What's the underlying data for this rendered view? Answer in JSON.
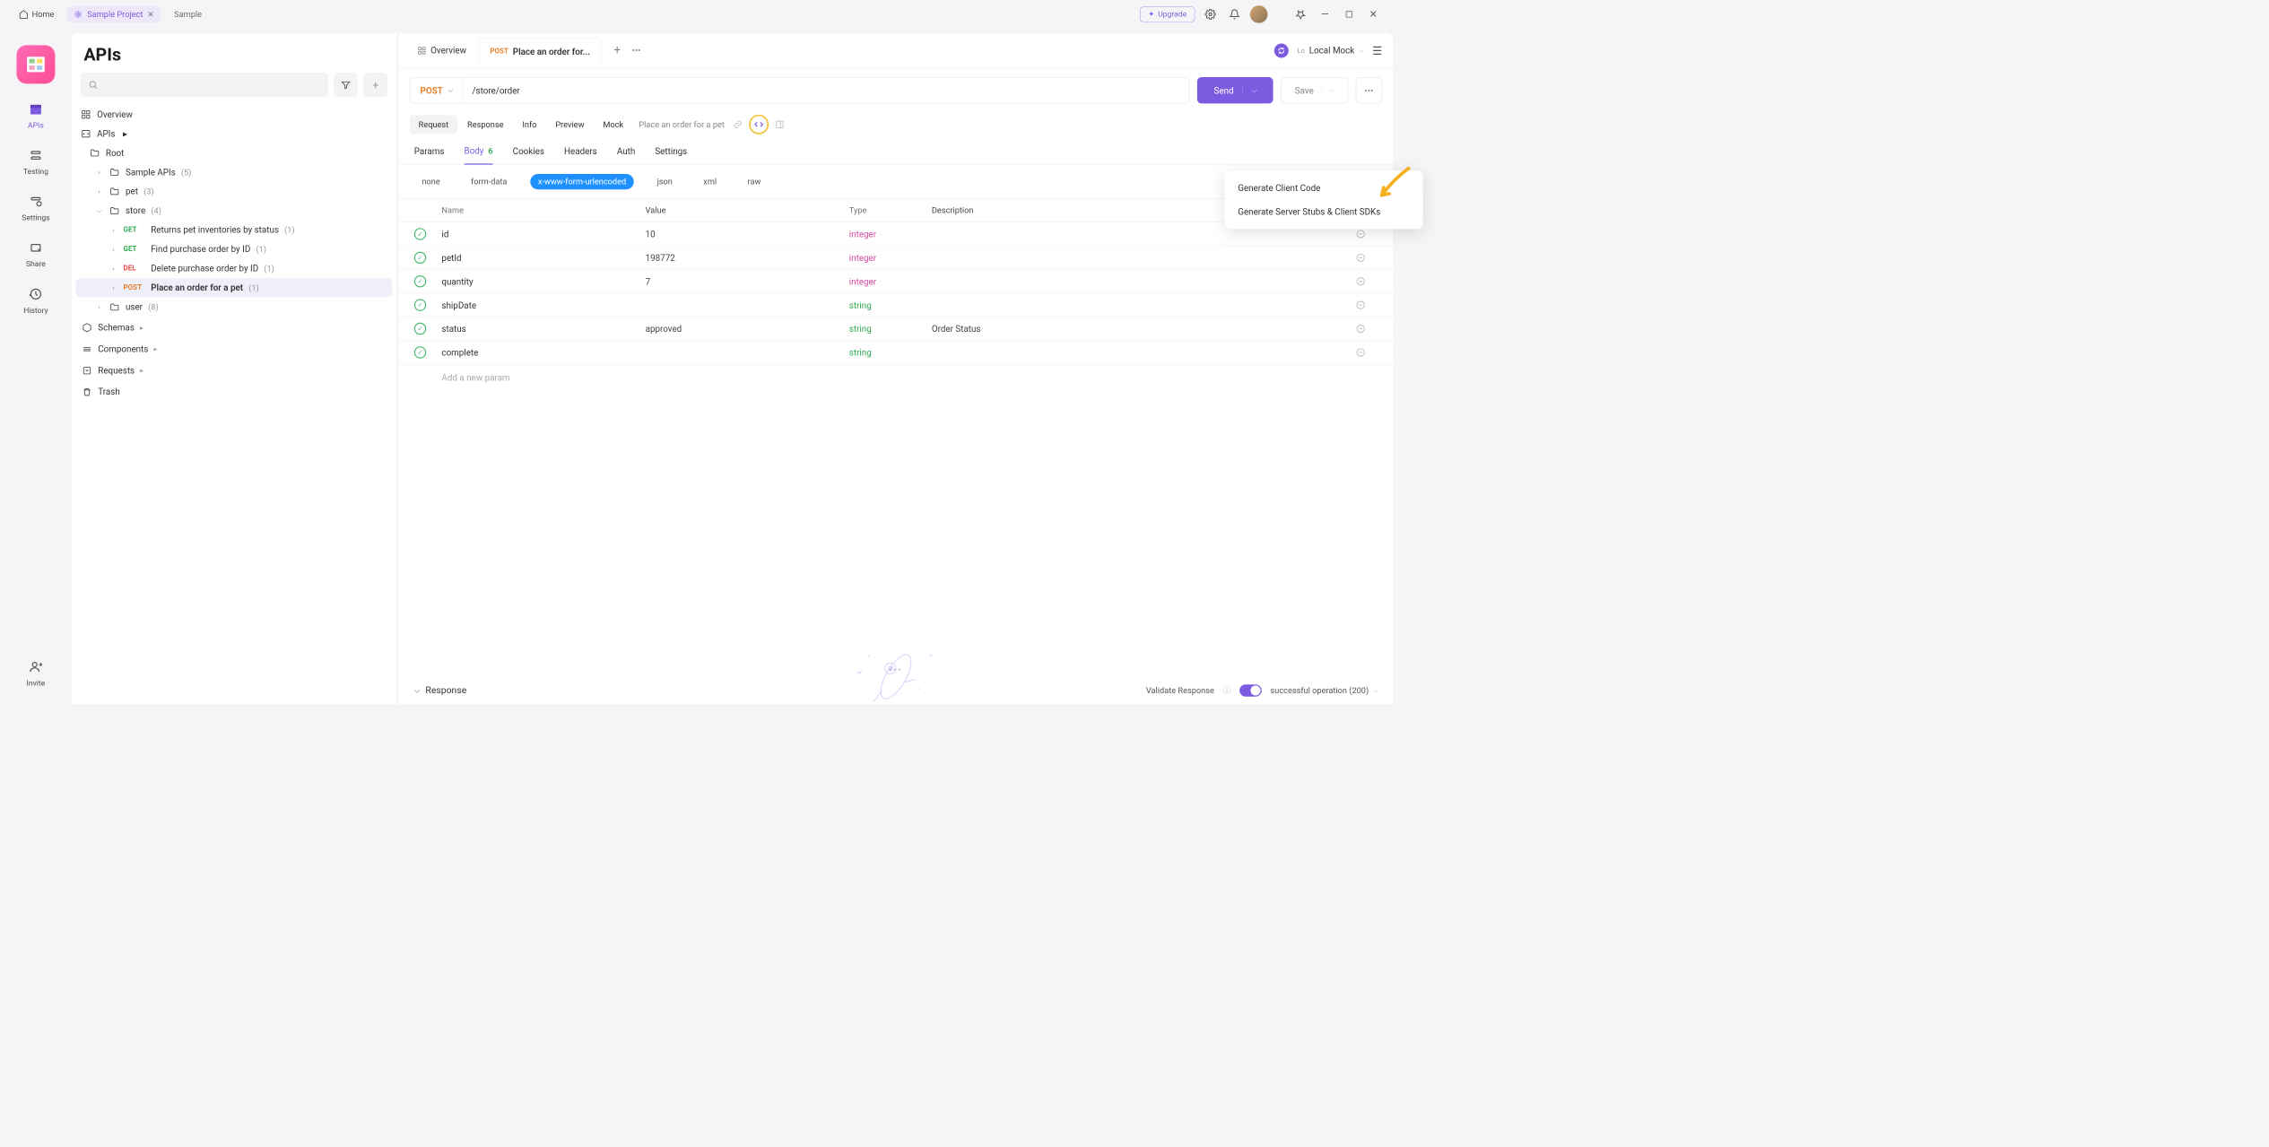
{
  "titlebar": {
    "home": "Home",
    "active_tab": "Sample Project",
    "plain_tab": "Sample",
    "upgrade": "Upgrade"
  },
  "rail": {
    "items": [
      {
        "label": "APIs",
        "icon": "📅"
      },
      {
        "label": "Testing",
        "icon": "≋"
      },
      {
        "label": "Settings",
        "icon": "⚙"
      },
      {
        "label": "Share",
        "icon": "🖵"
      },
      {
        "label": "History",
        "icon": "🕓"
      }
    ],
    "invite": "Invite"
  },
  "panel": {
    "title": "APIs",
    "search_placeholder": "",
    "overview": "Overview",
    "apis_label": "APIs",
    "root": "Root",
    "folders": [
      {
        "name": "Sample APIs",
        "count": "(5)"
      },
      {
        "name": "pet",
        "count": "(3)"
      },
      {
        "name": "store",
        "count": "(4)",
        "expanded": true,
        "children": [
          {
            "method": "GET",
            "name": "Returns pet inventories by status",
            "count": "(1)"
          },
          {
            "method": "GET",
            "name": "Find purchase order by ID",
            "count": "(1)"
          },
          {
            "method": "DEL",
            "name": "Delete purchase order by ID",
            "count": "(1)"
          },
          {
            "method": "POST",
            "name": "Place an order for a pet",
            "count": "(1)",
            "selected": true
          }
        ]
      },
      {
        "name": "user",
        "count": "(8)"
      }
    ],
    "sections": [
      "Schemas",
      "Components",
      "Requests",
      "Trash"
    ]
  },
  "main": {
    "tabs": [
      {
        "label": "Overview",
        "type": "overview"
      },
      {
        "label": "Place an order for...",
        "method": "POST",
        "active": true
      }
    ],
    "env": {
      "short": "Lo",
      "name": "Local Mock"
    },
    "method": "POST",
    "url": "/store/order",
    "send": "Send",
    "save": "Save",
    "sub_tabs": [
      "Request",
      "Response",
      "Info",
      "Preview",
      "Mock"
    ],
    "sub_active": "Request",
    "description": "Place an order for a pet",
    "code_menu": {
      "items": [
        "Generate Client Code",
        "Generate Server Stubs & Client SDKs"
      ]
    },
    "section_tabs": [
      "Params",
      "Body",
      "Cookies",
      "Headers",
      "Auth",
      "Settings"
    ],
    "section_active": "Body",
    "body_badge": "6",
    "body_types": [
      "none",
      "form-data",
      "x-www-form-urlencoded",
      "json",
      "xml",
      "raw"
    ],
    "body_type_active": "x-www-form-urlencoded",
    "table": {
      "headers": {
        "name": "Name",
        "value": "Value",
        "type": "Type",
        "description": "Description"
      },
      "rows": [
        {
          "name": "id",
          "value": "10",
          "type": "integer",
          "type_class": "int",
          "desc": ""
        },
        {
          "name": "petId",
          "value": "198772",
          "type": "integer",
          "type_class": "int",
          "desc": ""
        },
        {
          "name": "quantity",
          "value": "7",
          "type": "integer",
          "type_class": "int",
          "desc": ""
        },
        {
          "name": "shipDate",
          "value": "",
          "type": "string",
          "type_class": "str",
          "desc": ""
        },
        {
          "name": "status",
          "value": "approved",
          "type": "string",
          "type_class": "str",
          "desc": "Order Status"
        },
        {
          "name": "complete",
          "value": "",
          "type": "string",
          "type_class": "str",
          "desc": ""
        }
      ],
      "add_placeholder": "Add a new param"
    },
    "response": {
      "label": "Response",
      "validate": "Validate Response",
      "status": "successful operation (200)"
    }
  }
}
